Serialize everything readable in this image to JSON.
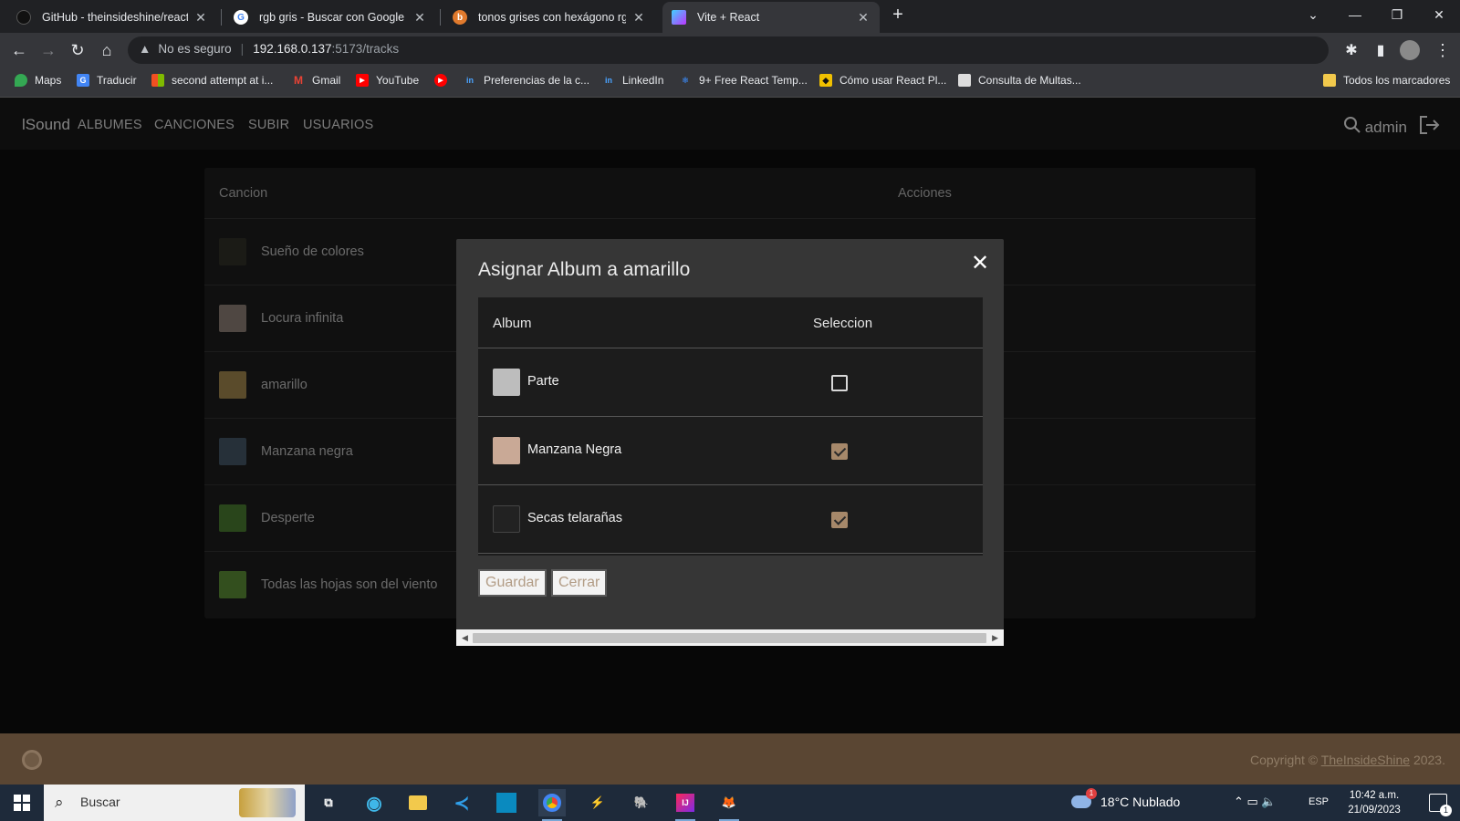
{
  "browser": {
    "tabs": [
      {
        "title": "GitHub - theinsideshine/react-ins",
        "icon": "github-icon",
        "color": "#111111"
      },
      {
        "title": "rgb gris - Buscar con Google",
        "icon": "google-icon",
        "color": "#ffffff"
      },
      {
        "title": "tonos grises con hexágono rgb p",
        "icon": "brave-icon",
        "color": "#e07a2d"
      },
      {
        "title": "Vite + React",
        "icon": "vite-icon",
        "color": "#9f6bff"
      }
    ],
    "active_tab_index": 3,
    "security_label": "No es seguro",
    "url_host": "192.168.0.137",
    "url_rest": ":5173/tracks",
    "bookmarks": [
      {
        "label": "Maps",
        "icon": "maps-icon",
        "color": "#34a853"
      },
      {
        "label": "Traducir",
        "icon": "translate-icon",
        "color": "#4285f4"
      },
      {
        "label": "second attempt at i...",
        "icon": "microsoft-icon",
        "color": "#f25022"
      },
      {
        "label": "Gmail",
        "icon": "gmail-icon",
        "color": "#ea4335"
      },
      {
        "label": "YouTube",
        "icon": "youtube-icon",
        "color": "#ff0000"
      },
      {
        "label": "",
        "icon": "youtube-music-icon",
        "color": "#ff0000"
      },
      {
        "label": "Preferencias de la c...",
        "icon": "linkedin-icon",
        "color": "#0a66c2"
      },
      {
        "label": "LinkedIn",
        "icon": "linkedin-icon",
        "color": "#0a66c2"
      },
      {
        "label": "9+ Free React Temp...",
        "icon": "react-icon",
        "color": "#3a7bd5"
      },
      {
        "label": "Cómo usar React Pl...",
        "icon": "cat-icon",
        "color": "#f0c000"
      },
      {
        "label": "Consulta de Multas...",
        "icon": "doc-icon",
        "color": "#dddddd"
      }
    ],
    "all_bookmarks_label": "Todos los marcadores"
  },
  "app": {
    "brand": "lSound",
    "nav": [
      "ALBUMES",
      "CANCIONES",
      "SUBIR",
      "USUARIOS"
    ],
    "username": "admin",
    "table": {
      "headers": [
        "Cancion",
        "Acciones"
      ],
      "rows": [
        {
          "name": "Sueño de colores",
          "thumb": "#2a2a22"
        },
        {
          "name": "Locura infinita",
          "thumb": "#7a6e66"
        },
        {
          "name": "amarillo",
          "thumb": "#8a7443"
        },
        {
          "name": "Manzana negra",
          "thumb": "#3b4a58"
        },
        {
          "name": "Desperte",
          "thumb": "#3f6a2a"
        },
        {
          "name": "Todas las hojas son del viento",
          "thumb": "#4f7a2f"
        }
      ]
    },
    "footer": {
      "copyright_prefix": "Copyright © ",
      "copyright_link": "TheInsideShine",
      "copyright_suffix": " 2023."
    }
  },
  "modal": {
    "title": "Asignar Album a amarillo",
    "headers": [
      "Album",
      "Seleccion"
    ],
    "albums": [
      {
        "name": "Parte",
        "checked": false,
        "thumb": "#bdbdbd"
      },
      {
        "name": "Manzana Negra",
        "checked": true,
        "thumb": "#c9a996"
      },
      {
        "name": "Secas telarañas",
        "checked": true,
        "thumb": "#222222"
      }
    ],
    "save_label": "Guardar",
    "close_label": "Cerrar"
  },
  "taskbar": {
    "search_placeholder": "Buscar",
    "weather": "18°C  Nublado",
    "weather_badge": "1",
    "language": "ESP",
    "time": "10:42 a.m.",
    "date": "21/09/2023",
    "notification_count": "1"
  }
}
